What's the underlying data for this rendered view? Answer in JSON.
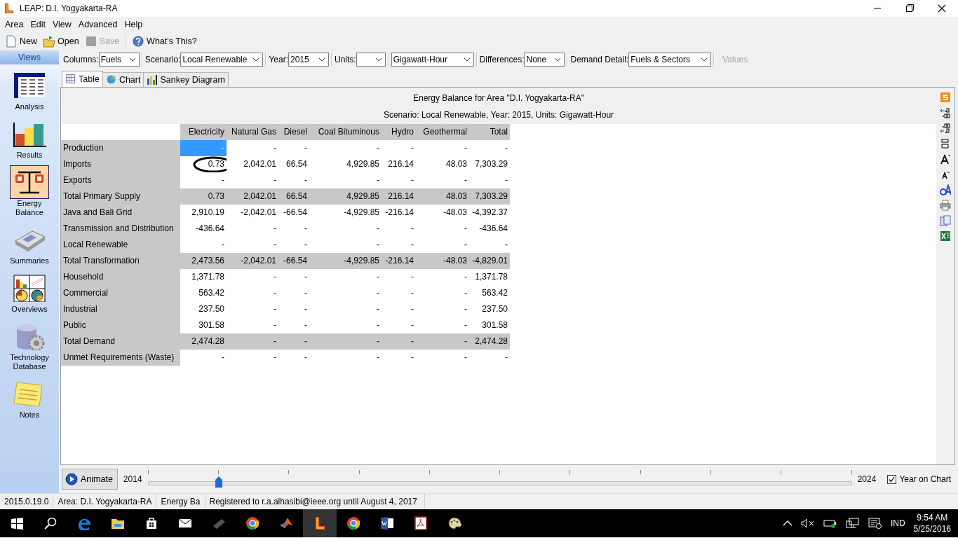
{
  "window": {
    "title": "LEAP: D.I. Yogyakarta-RA"
  },
  "menu": [
    "Area",
    "Edit",
    "View",
    "Advanced",
    "Help"
  ],
  "toolbar": [
    {
      "label": "New",
      "disabled": false
    },
    {
      "label": "Open",
      "disabled": false
    },
    {
      "label": "Save",
      "disabled": true
    },
    {
      "label": "What's This?",
      "disabled": false
    }
  ],
  "sidebar": {
    "title": "Views",
    "items": [
      {
        "label": "Analysis",
        "selected": false
      },
      {
        "label": "Results",
        "selected": false
      },
      {
        "label": "Energy Balance",
        "selected": true
      },
      {
        "label": "Summaries",
        "selected": false
      },
      {
        "label": "Overviews",
        "selected": false
      },
      {
        "label": "Technology Database",
        "selected": false
      },
      {
        "label": "Notes",
        "selected": false
      }
    ]
  },
  "options": [
    {
      "label": "Columns:",
      "value": "Fuels"
    },
    {
      "label": "Scenario:",
      "value": "Local Renewable"
    },
    {
      "label": "Year:",
      "value": "2015"
    },
    {
      "label": "Units:"
    },
    {
      "value": "Gigawatt-Hour"
    },
    {
      "label": "Differences:",
      "value": "None"
    },
    {
      "label": "Demand Detail:",
      "value": "Fuels & Sectors"
    }
  ],
  "values_button": {
    "label": "Values",
    "disabled": true
  },
  "tabs": [
    {
      "label": "Table",
      "selected": true
    },
    {
      "label": "Chart",
      "selected": false
    },
    {
      "label": "Sankey Diagram",
      "selected": false
    }
  ],
  "report": {
    "title": "Energy Balance for Area \"D.I. Yogyakarta-RA\"",
    "subtitle": "Scenario: Local Renewable, Year: 2015, Units: Gigawatt-Hour"
  },
  "table": {
    "columns": [
      "Electricity",
      "Natural Gas",
      "Diesel",
      "Coal Bituminous",
      "Hydro",
      "Geothermal",
      "Total"
    ],
    "rows": [
      {
        "label": "Production",
        "kind": "normal",
        "cells": [
          {
            "v": "-",
            "selected": true,
            "circled": false
          },
          {
            "v": "-",
            "selected": false,
            "circled": false
          },
          {
            "v": "-",
            "selected": false,
            "circled": false
          },
          {
            "v": "-",
            "selected": false,
            "circled": false
          },
          {
            "v": "-",
            "selected": false,
            "circled": false
          },
          {
            "v": "-",
            "selected": false,
            "circled": false
          },
          {
            "v": "-",
            "selected": false,
            "circled": false
          }
        ]
      },
      {
        "label": "Imports",
        "kind": "normal",
        "cells": [
          {
            "v": "0.73",
            "selected": false,
            "circled": true
          },
          {
            "v": "2,042.01",
            "selected": false,
            "circled": false
          },
          {
            "v": "66.54",
            "selected": false,
            "circled": false
          },
          {
            "v": "4,929.85",
            "selected": false,
            "circled": false
          },
          {
            "v": "216.14",
            "selected": false,
            "circled": false
          },
          {
            "v": "48.03",
            "selected": false,
            "circled": false
          },
          {
            "v": "7,303.29",
            "selected": false,
            "circled": false
          }
        ]
      },
      {
        "label": "Exports",
        "kind": "normal",
        "cells": [
          {
            "v": "-",
            "selected": false,
            "circled": false
          },
          {
            "v": "-",
            "selected": false,
            "circled": false
          },
          {
            "v": "-",
            "selected": false,
            "circled": false
          },
          {
            "v": "-",
            "selected": false,
            "circled": false
          },
          {
            "v": "-",
            "selected": false,
            "circled": false
          },
          {
            "v": "-",
            "selected": false,
            "circled": false
          },
          {
            "v": "-",
            "selected": false,
            "circled": false
          }
        ]
      },
      {
        "label": "Total Primary Supply",
        "kind": "total",
        "cells": [
          {
            "v": "0.73",
            "selected": false,
            "circled": false
          },
          {
            "v": "2,042.01",
            "selected": false,
            "circled": false
          },
          {
            "v": "66.54",
            "selected": false,
            "circled": false
          },
          {
            "v": "4,929.85",
            "selected": false,
            "circled": false
          },
          {
            "v": "216.14",
            "selected": false,
            "circled": false
          },
          {
            "v": "48.03",
            "selected": false,
            "circled": false
          },
          {
            "v": "7,303.29",
            "selected": false,
            "circled": false
          }
        ]
      },
      {
        "label": "Java and Bali Grid",
        "kind": "normal",
        "cells": [
          {
            "v": "2,910.19",
            "selected": false,
            "circled": false
          },
          {
            "v": "-2,042.01",
            "selected": false,
            "circled": false
          },
          {
            "v": "-66.54",
            "selected": false,
            "circled": false
          },
          {
            "v": "-4,929.85",
            "selected": false,
            "circled": false
          },
          {
            "v": "-216.14",
            "selected": false,
            "circled": false
          },
          {
            "v": "-48.03",
            "selected": false,
            "circled": false
          },
          {
            "v": "-4,392.37",
            "selected": false,
            "circled": false
          }
        ]
      },
      {
        "label": "Transmission and Distribution",
        "kind": "normal",
        "cells": [
          {
            "v": "-436.64",
            "selected": false,
            "circled": false
          },
          {
            "v": "-",
            "selected": false,
            "circled": false
          },
          {
            "v": "-",
            "selected": false,
            "circled": false
          },
          {
            "v": "-",
            "selected": false,
            "circled": false
          },
          {
            "v": "-",
            "selected": false,
            "circled": false
          },
          {
            "v": "-",
            "selected": false,
            "circled": false
          },
          {
            "v": "-436.64",
            "selected": false,
            "circled": false
          }
        ]
      },
      {
        "label": "Local Renewable",
        "kind": "normal",
        "cells": [
          {
            "v": "-",
            "selected": false,
            "circled": false
          },
          {
            "v": "-",
            "selected": false,
            "circled": false
          },
          {
            "v": "-",
            "selected": false,
            "circled": false
          },
          {
            "v": "-",
            "selected": false,
            "circled": false
          },
          {
            "v": "-",
            "selected": false,
            "circled": false
          },
          {
            "v": "-",
            "selected": false,
            "circled": false
          },
          {
            "v": "-",
            "selected": false,
            "circled": false
          }
        ]
      },
      {
        "label": "Total Transformation",
        "kind": "total",
        "cells": [
          {
            "v": "2,473.56",
            "selected": false,
            "circled": false
          },
          {
            "v": "-2,042.01",
            "selected": false,
            "circled": false
          },
          {
            "v": "-66.54",
            "selected": false,
            "circled": false
          },
          {
            "v": "-4,929.85",
            "selected": false,
            "circled": false
          },
          {
            "v": "-216.14",
            "selected": false,
            "circled": false
          },
          {
            "v": "-48.03",
            "selected": false,
            "circled": false
          },
          {
            "v": "-4,829.01",
            "selected": false,
            "circled": false
          }
        ]
      },
      {
        "label": "Household",
        "kind": "normal",
        "cells": [
          {
            "v": "1,371.78",
            "selected": false,
            "circled": false
          },
          {
            "v": "-",
            "selected": false,
            "circled": false
          },
          {
            "v": "-",
            "selected": false,
            "circled": false
          },
          {
            "v": "-",
            "selected": false,
            "circled": false
          },
          {
            "v": "-",
            "selected": false,
            "circled": false
          },
          {
            "v": "-",
            "selected": false,
            "circled": false
          },
          {
            "v": "1,371.78",
            "selected": false,
            "circled": false
          }
        ]
      },
      {
        "label": "Commercial",
        "kind": "normal",
        "cells": [
          {
            "v": "563.42",
            "selected": false,
            "circled": false
          },
          {
            "v": "-",
            "selected": false,
            "circled": false
          },
          {
            "v": "-",
            "selected": false,
            "circled": false
          },
          {
            "v": "-",
            "selected": false,
            "circled": false
          },
          {
            "v": "-",
            "selected": false,
            "circled": false
          },
          {
            "v": "-",
            "selected": false,
            "circled": false
          },
          {
            "v": "563.42",
            "selected": false,
            "circled": false
          }
        ]
      },
      {
        "label": "Industrial",
        "kind": "normal",
        "cells": [
          {
            "v": "237.50",
            "selected": false,
            "circled": false
          },
          {
            "v": "-",
            "selected": false,
            "circled": false
          },
          {
            "v": "-",
            "selected": false,
            "circled": false
          },
          {
            "v": "-",
            "selected": false,
            "circled": false
          },
          {
            "v": "-",
            "selected": false,
            "circled": false
          },
          {
            "v": "-",
            "selected": false,
            "circled": false
          },
          {
            "v": "237.50",
            "selected": false,
            "circled": false
          }
        ]
      },
      {
        "label": "Public",
        "kind": "normal",
        "cells": [
          {
            "v": "301.58",
            "selected": false,
            "circled": false
          },
          {
            "v": "-",
            "selected": false,
            "circled": false
          },
          {
            "v": "-",
            "selected": false,
            "circled": false
          },
          {
            "v": "-",
            "selected": false,
            "circled": false
          },
          {
            "v": "-",
            "selected": false,
            "circled": false
          },
          {
            "v": "-",
            "selected": false,
            "circled": false
          },
          {
            "v": "301.58",
            "selected": false,
            "circled": false
          }
        ]
      },
      {
        "label": "Total Demand",
        "kind": "total",
        "cells": [
          {
            "v": "2,474.28",
            "selected": false,
            "circled": false
          },
          {
            "v": "-",
            "selected": false,
            "circled": false
          },
          {
            "v": "-",
            "selected": false,
            "circled": false
          },
          {
            "v": "-",
            "selected": false,
            "circled": false
          },
          {
            "v": "-",
            "selected": false,
            "circled": false
          },
          {
            "v": "-",
            "selected": false,
            "circled": false
          },
          {
            "v": "2,474.28",
            "selected": false,
            "circled": false
          }
        ]
      },
      {
        "label": "Unmet Requirements (Waste)",
        "kind": "normal",
        "cells": [
          {
            "v": "-",
            "selected": false,
            "circled": false
          },
          {
            "v": "-",
            "selected": false,
            "circled": false
          },
          {
            "v": "-",
            "selected": false,
            "circled": false
          },
          {
            "v": "-",
            "selected": false,
            "circled": false
          },
          {
            "v": "-",
            "selected": false,
            "circled": false
          },
          {
            "v": "-",
            "selected": false,
            "circled": false
          },
          {
            "v": "-",
            "selected": false,
            "circled": false
          }
        ]
      }
    ]
  },
  "animate": {
    "button": "Animate",
    "start": "2014",
    "end": "2024",
    "level": 0.1,
    "year_on_chart": {
      "label": "Year on Chart",
      "checked": true
    }
  },
  "status_bar": [
    "2015.0.19.0",
    "Area: D.I. Yogyakarta-RA",
    "Energy Ba",
    "Registered to r.a.alhasibi@ieee.org until August 4, 2017"
  ],
  "taskbar": {
    "language": "IND",
    "time": "9:54 AM",
    "date": "5/25/2016"
  }
}
